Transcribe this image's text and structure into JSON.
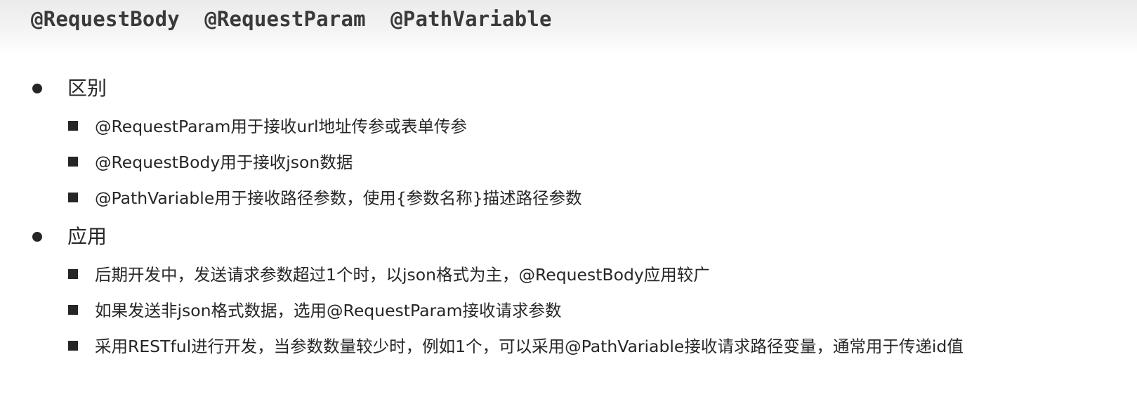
{
  "title": "@RequestBody  @RequestParam  @PathVariable",
  "sections": [
    {
      "heading": "区别",
      "items": [
        "@RequestParam用于接收url地址传参或表单传参",
        "@RequestBody用于接收json数据",
        "@PathVariable用于接收路径参数，使用{参数名称}描述路径参数"
      ]
    },
    {
      "heading": "应用",
      "items": [
        "后期开发中，发送请求参数超过1个时，以json格式为主，@RequestBody应用较广",
        "如果发送非json格式数据，选用@RequestParam接收请求参数",
        "采用RESTful进行开发，当参数数量较少时，例如1个，可以采用@PathVariable接收请求路径变量，通常用于传递id值"
      ]
    }
  ]
}
